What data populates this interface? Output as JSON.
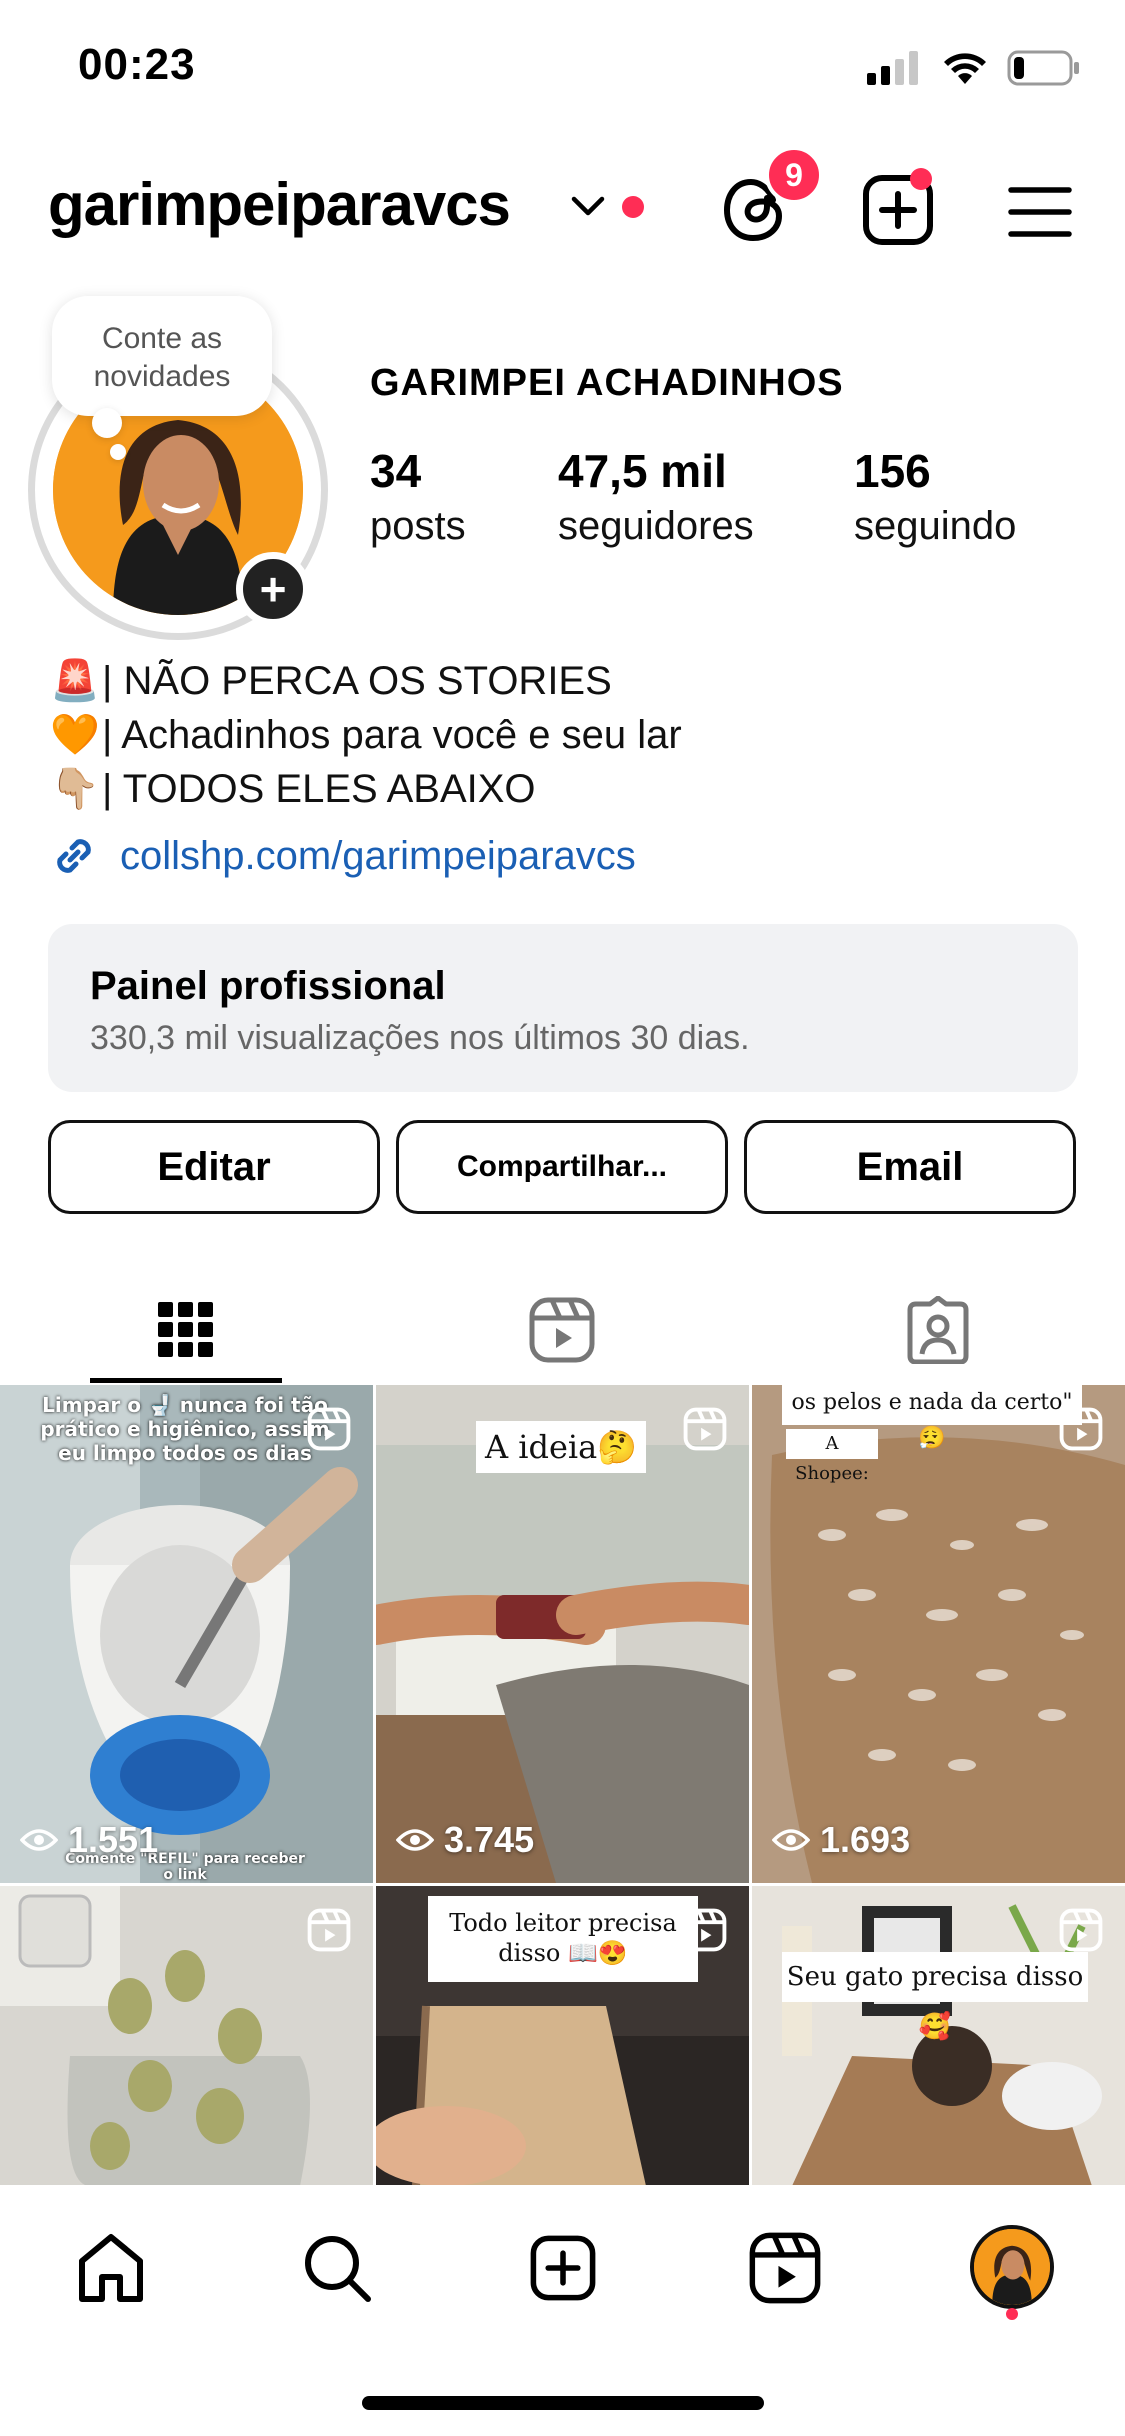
{
  "status_bar": {
    "time": "00:23",
    "battery_level": 0.2
  },
  "header": {
    "username": "garimpeiparavcs",
    "threads_badge": "9"
  },
  "profile": {
    "note": "Conte as novidades",
    "display_name": "GARIMPEI ACHADINHOS",
    "stats": [
      {
        "value": "34",
        "label": "posts"
      },
      {
        "value": "47,5 mil",
        "label": "seguidores"
      },
      {
        "value": "156",
        "label": "seguindo"
      }
    ],
    "bio": [
      {
        "emoji": "🚨",
        "text": "| NÃO PERCA OS STORIES"
      },
      {
        "emoji": "🧡",
        "text": "| Achadinhos para você e seu lar"
      },
      {
        "emoji": "👇🏼",
        "text": "| TODOS ELES ABAIXO"
      }
    ],
    "link": "collshp.com/garimpeiparavcs"
  },
  "pro_panel": {
    "title": "Painel profissional",
    "subtitle": "330,3 mil visualizações nos últimos 30 dias."
  },
  "buttons": {
    "edit": "Editar",
    "share": "Compartilhar...",
    "email": "Email"
  },
  "grid": [
    {
      "views": "1.551",
      "caption_top": "Limpar o 🚽 nunca foi tão prático e higiênico, assim eu limpo todos os dias",
      "caption_bottom": "Comente \"REFIL\" para receber o link"
    },
    {
      "views": "3.745",
      "caption": "A ideia🤔"
    },
    {
      "views": "1.693",
      "caption": "os pelos e nada da certo\" 😮‍💨",
      "caption2": "A Shopee:"
    },
    {
      "views": ""
    },
    {
      "views": "",
      "caption": "Todo leitor precisa disso 📖😍"
    },
    {
      "views": "",
      "caption": "Seu gato precisa disso 🥰"
    }
  ],
  "colors": {
    "accent_red": "#ff2d55",
    "link_blue": "#1a5fb4",
    "panel_bg": "#f1f2f4"
  }
}
